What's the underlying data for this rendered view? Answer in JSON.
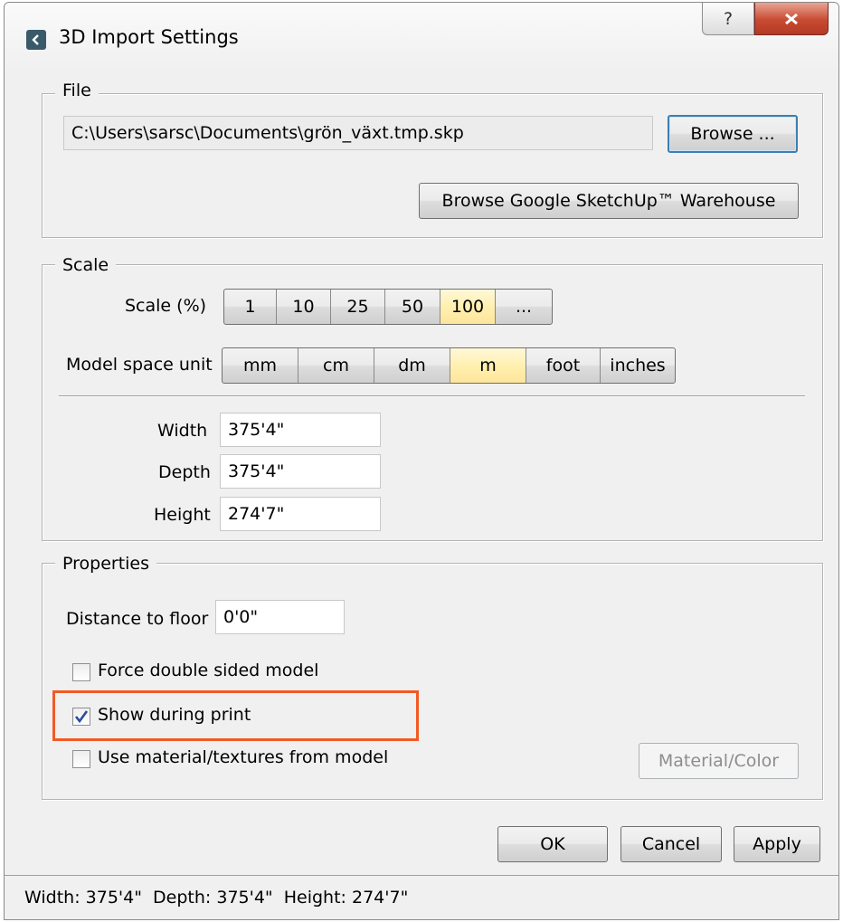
{
  "window": {
    "title": "3D Import Settings",
    "help_label": "?",
    "close_label": "x"
  },
  "file": {
    "legend": "File",
    "path_value": "C:\\Users\\sarsc\\Documents\\grön_växt.tmp.skp",
    "browse_label": "Browse ...",
    "warehouse_label": "Browse Google SketchUp™ Warehouse"
  },
  "scale": {
    "legend": "Scale",
    "scale_label": "Scale (%)",
    "scale_options": [
      "1",
      "10",
      "25",
      "50",
      "100",
      "..."
    ],
    "scale_selected": "100",
    "unit_label": "Model space unit",
    "unit_options": [
      "mm",
      "cm",
      "dm",
      "m",
      "foot",
      "inches"
    ],
    "unit_selected": "m",
    "width_label": "Width",
    "width_value": "375'4\"",
    "depth_label": "Depth",
    "depth_value": "375'4\"",
    "height_label": "Height",
    "height_value": "274'7\""
  },
  "properties": {
    "legend": "Properties",
    "distance_label": "Distance to floor",
    "distance_value": "0'0\"",
    "force_double_label": "Force double sided model",
    "force_double_checked": false,
    "show_print_label": "Show during print",
    "show_print_checked": true,
    "use_material_label": "Use material/textures from model",
    "use_material_checked": false,
    "material_color_label": "Material/Color"
  },
  "actions": {
    "ok_label": "OK",
    "cancel_label": "Cancel",
    "apply_label": "Apply"
  },
  "status": {
    "text": "Width: 375'4\"  Depth: 375'4\"  Height: 274'7\""
  },
  "colors": {
    "highlight": "#f15a24",
    "selected_segment": "#fff0b0",
    "close_button": "#c84a32"
  }
}
